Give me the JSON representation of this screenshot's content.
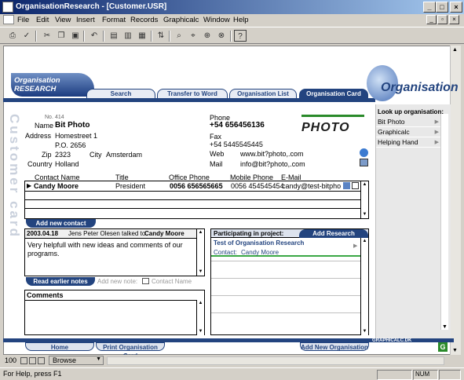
{
  "window": {
    "title": "OrganisationResearch - [Customer.USR]"
  },
  "menu": [
    "File",
    "Edit",
    "View",
    "Insert",
    "Format",
    "Records",
    "Graphicalc",
    "Window",
    "Help"
  ],
  "nav": {
    "tabs": [
      "Search",
      "Transfer to Word",
      "Organisation List",
      "Organisation Card"
    ],
    "logo_left": "Organisation\nRESEARCH",
    "logo_right": "Organisation"
  },
  "card": {
    "vertical_label": "Customer card",
    "no_label": "No.",
    "no_value": "414",
    "name_label": "Name",
    "name_value": "Bit Photo",
    "address_label": "Address",
    "address1": "Homestreet 1",
    "address2": "P.O. 2656",
    "zip_label": "Zip",
    "zip_value": "2323",
    "city_label": "City",
    "city_value": "Amsterdam",
    "country_label": "Country",
    "country_value": "Holland",
    "phone_label": "Phone",
    "phone_value": "+54 656456136",
    "fax_label": "Fax",
    "fax_value": "+54 5445545445",
    "web_label": "Web",
    "web_value": "www.bit?photo,.com",
    "mail_label": "Mail",
    "mail_value": "info@bit?photo,.com",
    "company_logo": "PHOTO"
  },
  "contacts": {
    "headers": [
      "Contact Name",
      "Title",
      "Office Phone",
      "Mobile Phone",
      "E-Mail"
    ],
    "rows": [
      {
        "name": "Candy Moore",
        "title": "President",
        "office": "0056 656565665",
        "mobile": "0056 454545454",
        "email": "candy@test-bitpho"
      }
    ],
    "add_button": "Add new contact"
  },
  "notes": {
    "date": "2003.04.18",
    "author": "Jens Peter Olesen talked to",
    "contact": "Candy Moore",
    "text": "Very helpfull with new ideas and comments of our programs.",
    "read_button": "Read earlier notes",
    "add_new_note": "Add new note:",
    "contact_name": "Contact Name"
  },
  "comments": {
    "title": "Comments"
  },
  "research": {
    "title": "Participating in project:",
    "add_button": "Add Research",
    "project": "Test of Organisation Research",
    "contact_label": "Contact:",
    "contact": "Candy Moore"
  },
  "lookup": {
    "title": "Look up organisation:",
    "items": [
      "Bit Photo",
      "Graphicalc",
      "Helping Hand"
    ]
  },
  "footer": {
    "home": "Home",
    "print": "Print Organisation Card",
    "add_new": "Add New Organisation",
    "brand": "GRAPHICALC.DK"
  },
  "bottom": {
    "zoom": "100",
    "mode": "Browse"
  },
  "status": {
    "text": "For Help, press F1",
    "num": "NUM"
  }
}
